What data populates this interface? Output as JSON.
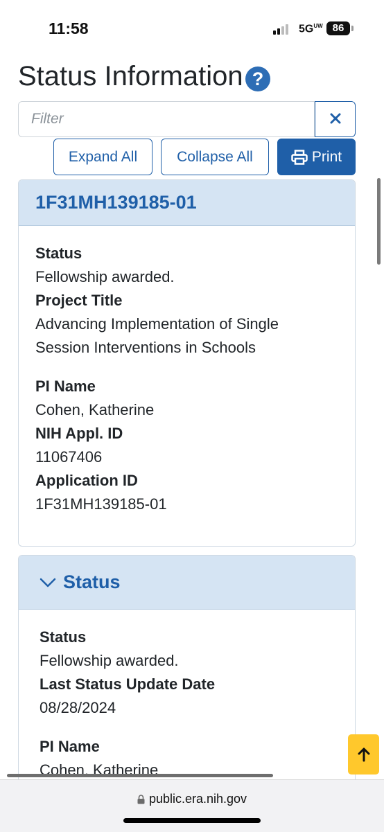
{
  "status_bar": {
    "time": "11:58",
    "network": "5G",
    "network_sup": "UW",
    "battery": "86"
  },
  "page": {
    "title": "Status Information"
  },
  "filter": {
    "placeholder": "Filter"
  },
  "toolbar": {
    "expand_all": "Expand All",
    "collapse_all": "Collapse All",
    "print": "Print"
  },
  "summary_card": {
    "header": "1F31MH139185-01",
    "fields": [
      {
        "label": "Status",
        "value": "Fellowship awarded."
      },
      {
        "label": "Project Title",
        "value": "Advancing Implementation of Single Session Interventions in Schools"
      },
      {
        "label": "PI Name",
        "value": "Cohen, Katherine"
      },
      {
        "label": "NIH Appl. ID",
        "value": "11067406"
      },
      {
        "label": "Application ID",
        "value": "1F31MH139185-01"
      }
    ]
  },
  "status_card": {
    "header": "Status",
    "fields": [
      {
        "label": "Status",
        "value": "Fellowship awarded."
      },
      {
        "label": "Last Status Update Date",
        "value": "08/28/2024"
      },
      {
        "label": "PI Name",
        "value": "Cohen, Katherine"
      }
    ]
  },
  "browser": {
    "url": "public.era.nih.gov"
  },
  "colors": {
    "primary": "#1f5fa8",
    "header_bg": "#d5e4f3",
    "back_to_top": "#ffc82c"
  },
  "icons": [
    "help-icon",
    "close-icon",
    "printer-icon",
    "chevron-down-icon",
    "arrow-up-icon",
    "lock-icon"
  ]
}
